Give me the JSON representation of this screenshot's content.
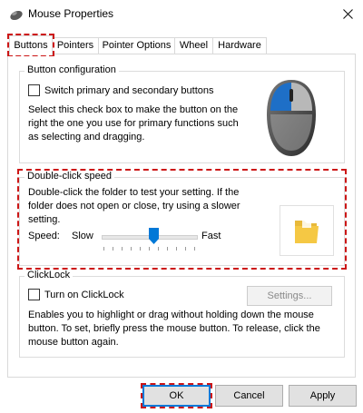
{
  "window": {
    "title": "Mouse Properties",
    "icon": "mouse-properties-icon"
  },
  "tabs": [
    {
      "label": "Buttons",
      "active": true
    },
    {
      "label": "Pointers"
    },
    {
      "label": "Pointer Options"
    },
    {
      "label": "Wheel"
    },
    {
      "label": "Hardware"
    }
  ],
  "button_config": {
    "legend": "Button configuration",
    "checkbox_label": "Switch primary and secondary buttons",
    "checked": false,
    "description_lines": [
      "Select this check box to make the button on the",
      "right the one you use for primary functions such",
      "as selecting and dragging."
    ]
  },
  "double_click": {
    "legend": "Double-click speed",
    "description_lines": [
      "Double-click the folder to test your setting. If the",
      "folder does not open or close, try using a slower",
      "setting."
    ],
    "speed_label": "Speed:",
    "slow_label": "Slow",
    "fast_label": "Fast",
    "speed_value_fraction": 0.55
  },
  "clicklock": {
    "legend": "ClickLock",
    "checkbox_label": "Turn on ClickLock",
    "checked": false,
    "settings_button": "Settings...",
    "description_lines": [
      "Enables you to highlight or drag without holding down the mouse",
      "button. To set, briefly press the mouse button. To release, click the",
      "mouse button again."
    ]
  },
  "buttons": {
    "ok": "OK",
    "cancel": "Cancel",
    "apply": "Apply"
  },
  "colors": {
    "highlight": "#cc1616",
    "accent": "#0078d7",
    "folder": "#f5c844"
  }
}
